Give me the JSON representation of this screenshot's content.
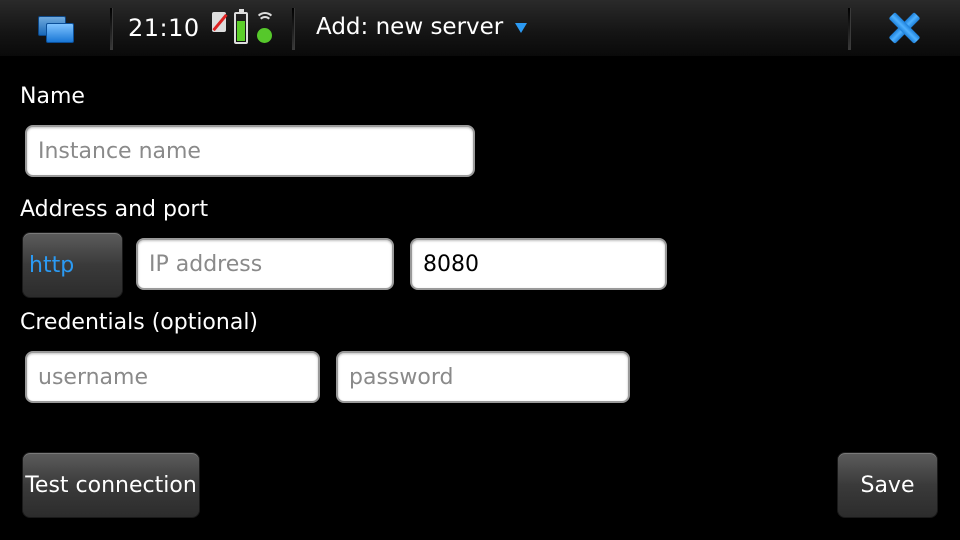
{
  "status_bar": {
    "time": "21:10",
    "title": "Add: new server",
    "icons": [
      "task-switcher-icon",
      "sim-icon",
      "battery-icon",
      "wifi-icon",
      "close-icon"
    ]
  },
  "form": {
    "name": {
      "label": "Name",
      "placeholder": "Instance name",
      "value": ""
    },
    "address": {
      "label": "Address and port",
      "protocol": "http",
      "ip_placeholder": "IP address",
      "ip_value": "",
      "port_value": "8080"
    },
    "credentials": {
      "label": "Credentials (optional)",
      "username_placeholder": "username",
      "username_value": "",
      "password_placeholder": "password",
      "password_value": ""
    }
  },
  "buttons": {
    "test_connection": "Test connection",
    "save": "Save"
  },
  "colors": {
    "accent": "#2b9af3",
    "background": "#000000",
    "battery_green": "#5ccf2a"
  }
}
